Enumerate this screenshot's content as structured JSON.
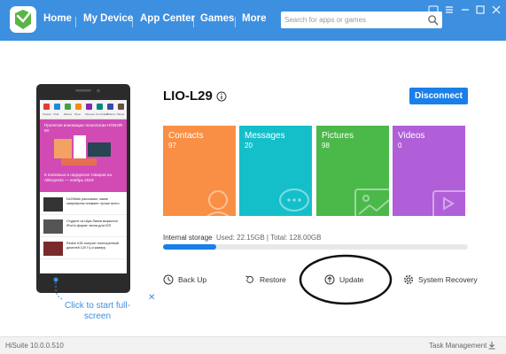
{
  "app": {
    "nav": [
      {
        "label": "Home",
        "active": true
      },
      {
        "label": "My Device",
        "active": false
      },
      {
        "label": "App Center",
        "active": false
      },
      {
        "label": "Games",
        "active": false
      },
      {
        "label": "More",
        "active": false
      }
    ],
    "search_placeholder": "Search for apps or games",
    "window_controls": [
      "feedback-icon",
      "menu-icon",
      "minimize-icon",
      "maximize-icon",
      "close-icon"
    ]
  },
  "phone": {
    "screen": {
      "apps": [
        "Трекер",
        "Chat",
        "Иконы",
        "Игры",
        "Музыка",
        "Голосовой",
        "Ответы",
        "Меню"
      ],
      "promo_top": "Пролетая инновации технологии HONOR 9X",
      "promo_bottom": "5 полезных и недорогих товаров на AliExpress — ноябрь 2019",
      "news": [
        "DxOMark рассказал, какие смартфоны снимают лучше всего",
        "Студент из Шри-Ланки вырастил iPod в форме чехла для iOS",
        "Redmi K30 получит полноценный дисплей 120 Гц и камеру"
      ]
    },
    "fullscreen_hint": "Click to start full-screen"
  },
  "device": {
    "name": "LIO-L29",
    "disconnect_label": "Disconnect"
  },
  "tiles": [
    {
      "label": "Contacts",
      "count": "97",
      "color": "#f98f44",
      "icon": "contact-icon"
    },
    {
      "label": "Messages",
      "count": "20",
      "color": "#15bfca",
      "icon": "message-icon"
    },
    {
      "label": "Pictures",
      "count": "98",
      "color": "#4bb84a",
      "icon": "picture-icon"
    },
    {
      "label": "Videos",
      "count": "0",
      "color": "#b05fd8",
      "icon": "video-icon"
    }
  ],
  "storage": {
    "label": "Internal storage",
    "detail": "Used: 22.15GB | Total: 128.00GB",
    "used_fraction": 0.173
  },
  "actions": [
    {
      "label": "Back Up",
      "icon": "backup-icon"
    },
    {
      "label": "Restore",
      "icon": "restore-icon"
    },
    {
      "label": "Update",
      "icon": "update-icon"
    },
    {
      "label": "System Recovery",
      "icon": "gear-icon"
    }
  ],
  "footer": {
    "version": "HiSuite 10.0.0.510",
    "task_management": "Task Management"
  },
  "colors": {
    "titlebar": "#3d8fe0",
    "accent": "#1a7fe8"
  }
}
